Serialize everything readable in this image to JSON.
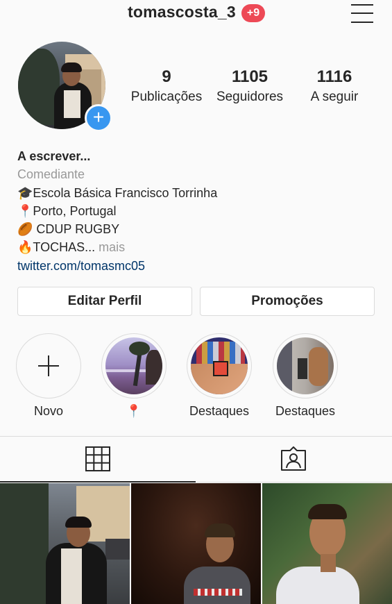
{
  "header": {
    "username": "tomascosta_3",
    "notification_badge": "+9",
    "menu_icon": "hamburger-menu-icon"
  },
  "stats": [
    {
      "value": "9",
      "label": "Publicações"
    },
    {
      "value": "1105",
      "label": "Seguidores"
    },
    {
      "value": "1116",
      "label": "A seguir"
    }
  ],
  "bio": {
    "name": "A escrever...",
    "category": "Comediante",
    "line1_emoji": "🎓",
    "line1": "Escola Básica Francisco Torrinha",
    "line2_emoji": "📍",
    "line2": "Porto, Portugal",
    "line3_emoji": "🏉",
    "line3": " CDUP RUGBY",
    "line4_emoji": "🔥",
    "line4": "TOCHAS...",
    "more": "mais",
    "link": "twitter.com/tomasmc05"
  },
  "buttons": {
    "edit_profile": "Editar Perfil",
    "promotions": "Promoções"
  },
  "highlights": [
    {
      "label": "Novo",
      "icon": "plus-icon"
    },
    {
      "label": "📍"
    },
    {
      "label": "Destaques"
    },
    {
      "label": "Destaques"
    }
  ],
  "tabs": [
    {
      "icon": "grid-icon",
      "active": true
    },
    {
      "icon": "tagged-person-icon",
      "active": false
    }
  ],
  "colors": {
    "accent": "#3897f0",
    "badge": "#ed4956",
    "link": "#003569",
    "muted": "#999999",
    "border": "#dbdbdb"
  }
}
